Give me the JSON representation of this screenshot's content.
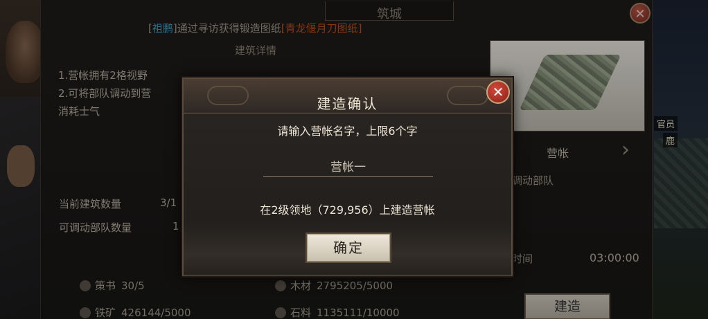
{
  "panel": {
    "title": "筑城",
    "found_prefix": "[",
    "found_who": "祖鹏",
    "found_mid": "]通过寻访获得锻造图纸",
    "found_item": "[青龙偃月刀图纸]",
    "detail_heading": "建筑详情",
    "desc": [
      "1.营帐拥有2格视野",
      "2.可将部队调动到营",
      "消耗士气"
    ],
    "stats": {
      "count_label": "当前建筑数量",
      "count_value": "3/1",
      "troops_label": "可调动部队数量",
      "troops_value": "1"
    },
    "resources": [
      {
        "name": "策书",
        "value": "30/5"
      },
      {
        "name": "木材",
        "value": "2795205/5000"
      },
      {
        "name": "铁矿",
        "value": "426144/5000"
      },
      {
        "name": "石料",
        "value": "1135111/10000"
      }
    ],
    "building_name": "营帐",
    "building_desc_partial": "调动部队",
    "time_label": "时间",
    "time_value": "03:00:00",
    "build_button": "建造"
  },
  "right_map": {
    "tag_1": "官员",
    "tag_2": "鹿"
  },
  "dialog": {
    "title": "建造确认",
    "close_symbol": "✕",
    "prompt": "请输入营帐名字，上限6个字",
    "input_value": "营帐一",
    "location": "在2级领地（729,956）上建造营帐",
    "confirm_label": "确定"
  }
}
